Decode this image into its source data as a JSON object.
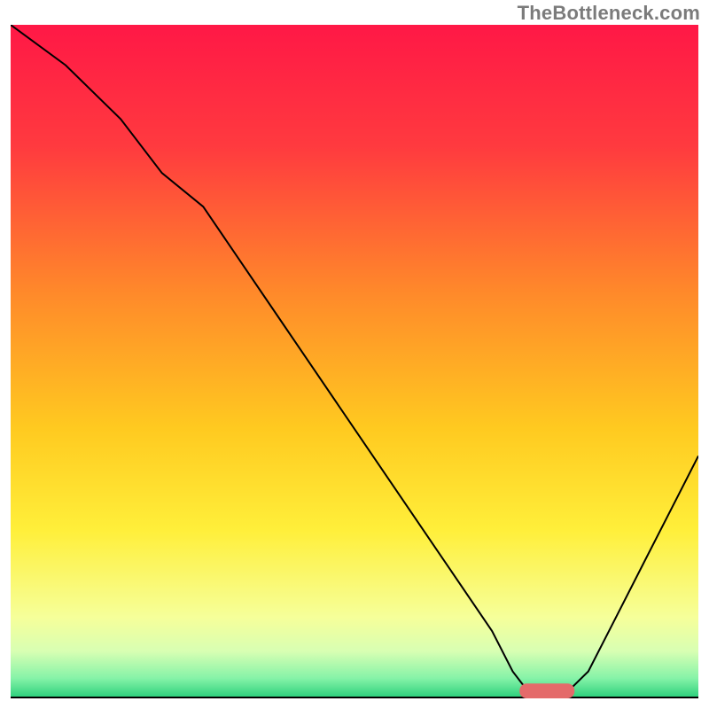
{
  "watermark": "TheBottleneck.com",
  "chart_data": {
    "type": "line",
    "title": "",
    "xlabel": "",
    "ylabel": "",
    "xlim": [
      0,
      100
    ],
    "ylim": [
      0,
      100
    ],
    "grid": false,
    "legend": false,
    "background_gradient_stops": [
      {
        "offset": 0.0,
        "color": "#ff1846"
      },
      {
        "offset": 0.18,
        "color": "#ff3a3f"
      },
      {
        "offset": 0.4,
        "color": "#ff8a2a"
      },
      {
        "offset": 0.6,
        "color": "#ffca20"
      },
      {
        "offset": 0.75,
        "color": "#ffef3a"
      },
      {
        "offset": 0.88,
        "color": "#f6ff9a"
      },
      {
        "offset": 0.93,
        "color": "#d8ffb3"
      },
      {
        "offset": 0.97,
        "color": "#86f3a8"
      },
      {
        "offset": 1.0,
        "color": "#28ce7a"
      }
    ],
    "series": [
      {
        "name": "bottleneck-curve",
        "color": "#000000",
        "stroke_width": 2,
        "x": [
          0,
          8,
          16,
          22,
          28,
          40,
          52,
          62,
          70,
          73,
          76,
          80,
          84,
          88,
          92,
          96,
          100
        ],
        "y": [
          100,
          94,
          86,
          78,
          73,
          55,
          37,
          22,
          10,
          4,
          0,
          0,
          4,
          12,
          20,
          28,
          36
        ]
      }
    ],
    "marker": {
      "name": "optimal-range-marker",
      "color": "#e46a6a",
      "x_start": 74,
      "x_end": 82,
      "y": 0,
      "thickness": 2.2
    }
  }
}
